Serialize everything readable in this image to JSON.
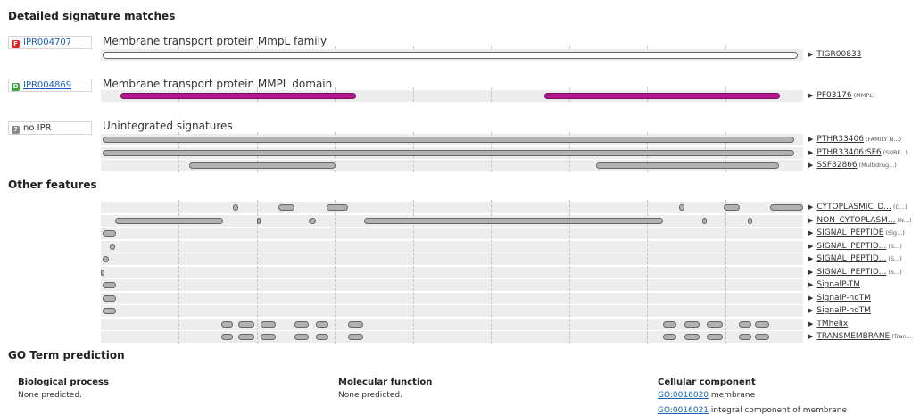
{
  "sections": {
    "detailed": "Detailed signature matches",
    "other": "Other features",
    "go": "GO Term prediction"
  },
  "entries": [
    {
      "badge": "F",
      "id": "IPR004707",
      "name": "Membrane transport protein MmpL family",
      "rows": [
        {
          "acc": "TIGR00833",
          "sub": "",
          "color": "white",
          "matches": [
            [
              0.2,
              99.3
            ]
          ]
        }
      ]
    },
    {
      "badge": "D",
      "id": "IPR004869",
      "name": "Membrane transport protein MMPL domain",
      "rows": [
        {
          "acc": "PF03176",
          "sub": "(MMPL)",
          "color": "magenta",
          "matches": [
            [
              2.8,
              36.4
            ],
            [
              63.1,
              96.7
            ]
          ]
        }
      ]
    },
    {
      "badge": "?",
      "id": "no IPR",
      "name": "Unintegrated signatures",
      "rows": [
        {
          "acc": "PTHR33406",
          "sub": "(FAMILY N...)",
          "color": "grey",
          "matches": [
            [
              0.2,
              98.7
            ]
          ]
        },
        {
          "acc": "PTHR33406:SF6",
          "sub": "(SUBF...)",
          "color": "grey",
          "matches": [
            [
              0.2,
              98.7
            ]
          ]
        },
        {
          "acc": "SSF82866",
          "sub": "(Multidrug...)",
          "color": "grey",
          "matches": [
            [
              12.6,
              33.4
            ],
            [
              70.5,
              96.6
            ]
          ]
        }
      ]
    }
  ],
  "features": [
    {
      "acc": "CYTOPLASMIC_D...",
      "sub": "(C...)",
      "matches": [
        [
          18.8,
          19.6
        ],
        [
          25.3,
          27.6
        ],
        [
          32.2,
          35.2
        ],
        [
          82.4,
          83.1
        ],
        [
          88.7,
          91.0
        ],
        [
          95.3,
          100
        ]
      ]
    },
    {
      "acc": "NON_CYTOPLASM...",
      "sub": "(N...)",
      "matches": [
        [
          2.0,
          17.4
        ],
        [
          22.2,
          22.8
        ],
        [
          29.6,
          30.6
        ],
        [
          37.5,
          80.0
        ],
        [
          85.6,
          86.3
        ],
        [
          92.1,
          92.7
        ]
      ]
    },
    {
      "acc": "SIGNAL_PEPTIDE",
      "sub": "(Sig...)",
      "matches": [
        [
          0.2,
          2.2
        ]
      ]
    },
    {
      "acc": "SIGNAL_PEPTID...",
      "sub": "(S...)",
      "matches": [
        [
          1.3,
          2.0
        ]
      ]
    },
    {
      "acc": "SIGNAL_PEPTID...",
      "sub": "(S...)",
      "matches": [
        [
          0.3,
          1.1
        ]
      ]
    },
    {
      "acc": "SIGNAL_PEPTID...",
      "sub": "(S...)",
      "matches": [
        [
          0,
          0.3
        ]
      ]
    },
    {
      "acc": "SignalP-TM",
      "sub": "",
      "matches": [
        [
          0.2,
          2.2
        ]
      ]
    },
    {
      "acc": "SignalP-noTM",
      "sub": "",
      "matches": [
        [
          0.2,
          2.2
        ]
      ]
    },
    {
      "acc": "SignalP-noTM",
      "sub": "",
      "matches": [
        [
          0.2,
          2.2
        ]
      ]
    },
    {
      "acc": "TMhelix",
      "sub": "",
      "matches": [
        [
          17.1,
          18.8
        ],
        [
          19.6,
          21.9
        ],
        [
          22.8,
          24.9
        ],
        [
          27.6,
          29.6
        ],
        [
          30.6,
          32.4
        ],
        [
          35.2,
          37.3
        ],
        [
          80.0,
          81.9
        ],
        [
          83.1,
          85.2
        ],
        [
          86.3,
          88.6
        ],
        [
          90.9,
          92.6
        ],
        [
          93.1,
          95.2
        ]
      ]
    },
    {
      "acc": "TRANSMEMBRANE",
      "sub": "(Tran...",
      "matches": [
        [
          17.1,
          18.8
        ],
        [
          19.6,
          21.9
        ],
        [
          22.8,
          24.9
        ],
        [
          27.6,
          29.6
        ],
        [
          30.6,
          32.4
        ],
        [
          35.2,
          37.3
        ],
        [
          80.0,
          81.9
        ],
        [
          83.1,
          85.2
        ],
        [
          86.3,
          88.6
        ],
        [
          90.9,
          92.6
        ],
        [
          93.1,
          95.2
        ]
      ]
    }
  ],
  "go": {
    "bio": {
      "title": "Biological process",
      "text": "None predicted."
    },
    "mol": {
      "title": "Molecular function",
      "text": "None predicted."
    },
    "cell": {
      "title": "Cellular component",
      "terms": [
        {
          "id": "GO:0016020",
          "name": "membrane"
        },
        {
          "id": "GO:0016021",
          "name": "integral component of membrane"
        }
      ]
    }
  }
}
